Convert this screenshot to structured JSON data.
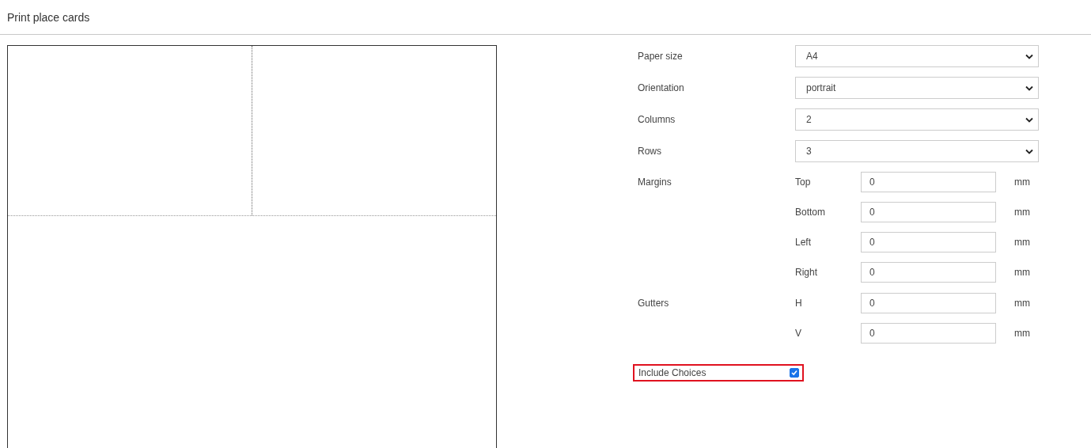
{
  "title": "Print place cards",
  "selects": [
    {
      "label": "Paper size",
      "value": "A4"
    },
    {
      "label": "Orientation",
      "value": "portrait"
    },
    {
      "label": "Columns",
      "value": "2"
    },
    {
      "label": "Rows",
      "value": "3"
    }
  ],
  "groups": [
    {
      "label": "Margins",
      "fields": [
        {
          "label": "Top",
          "value": "0",
          "unit": "mm"
        },
        {
          "label": "Bottom",
          "value": "0",
          "unit": "mm"
        },
        {
          "label": "Left",
          "value": "0",
          "unit": "mm"
        },
        {
          "label": "Right",
          "value": "0",
          "unit": "mm"
        }
      ]
    },
    {
      "label": "Gutters",
      "fields": [
        {
          "label": "H",
          "value": "0",
          "unit": "mm"
        },
        {
          "label": "V",
          "value": "0",
          "unit": "mm"
        }
      ]
    }
  ],
  "include_choices": {
    "label": "Include Choices",
    "checked": true,
    "highlighted": true
  }
}
